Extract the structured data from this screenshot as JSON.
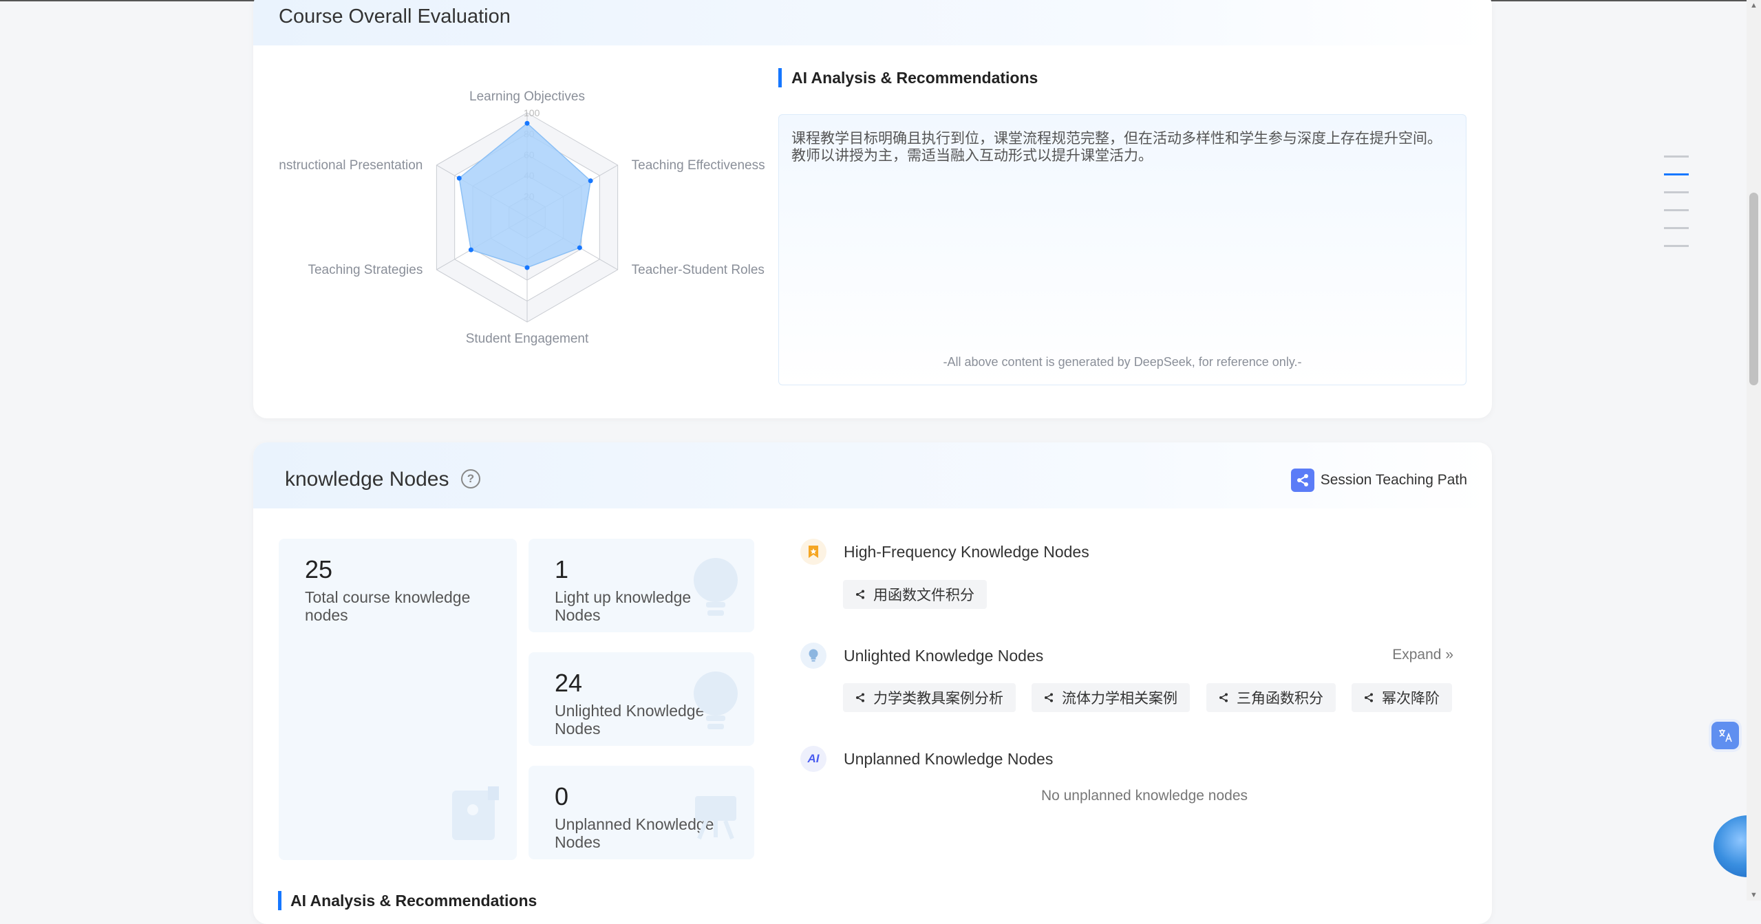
{
  "evaluation": {
    "title": "Course Overall Evaluation",
    "radar": {
      "axes": [
        "Learning Objectives",
        "Teaching Effectiveness",
        "Teacher-Student Roles",
        "Student Engagement",
        "Teaching Strategies",
        "Instructional Presentation"
      ],
      "values": [
        90,
        70,
        58,
        48,
        62,
        75
      ],
      "max": 100,
      "ticks": [
        "20",
        "40",
        "60",
        "80",
        "100"
      ],
      "fill_color": "#a9d1fb",
      "point_color": "#1677ff"
    },
    "ai": {
      "title": "AI Analysis & Recommendations",
      "text": "课程教学目标明确且执行到位，课堂流程规范完整，但在活动多样性和学生参与深度上存在提升空间。教师以讲授为主，需适当融入互动形式以提升课堂活力。",
      "note": "-All above content is generated by DeepSeek, for reference only.-"
    }
  },
  "knowledge": {
    "title": "knowledge Nodes",
    "help_icon": "question-circle-icon",
    "path_button": "Session Teaching Path",
    "stats": {
      "total": {
        "value": "25",
        "label": "Total course knowledge nodes"
      },
      "light": {
        "value": "1",
        "label": "Light up knowledge Nodes"
      },
      "unlit": {
        "value": "24",
        "label": "Unlighted Knowledge Nodes"
      },
      "unplanned": {
        "value": "0",
        "label": "Unplanned Knowledge Nodes"
      }
    },
    "high_frequency": {
      "title": "High-Frequency Knowledge Nodes",
      "items": [
        "用函数文件积分"
      ]
    },
    "unlighted": {
      "title": "Unlighted Knowledge Nodes",
      "expand": "Expand",
      "items": [
        "力学类教具案例分析",
        "流体力学相关案例",
        "三角函数积分",
        "幂次降阶"
      ]
    },
    "unplanned": {
      "title": "Unplanned Knowledge Nodes",
      "empty": "No unplanned knowledge nodes"
    },
    "ai_title": "AI Analysis & Recommendations"
  },
  "colors": {
    "accent": "#1677ff",
    "path_icon": "#5b7cf7",
    "high_freq_icon": "#f5a623"
  }
}
